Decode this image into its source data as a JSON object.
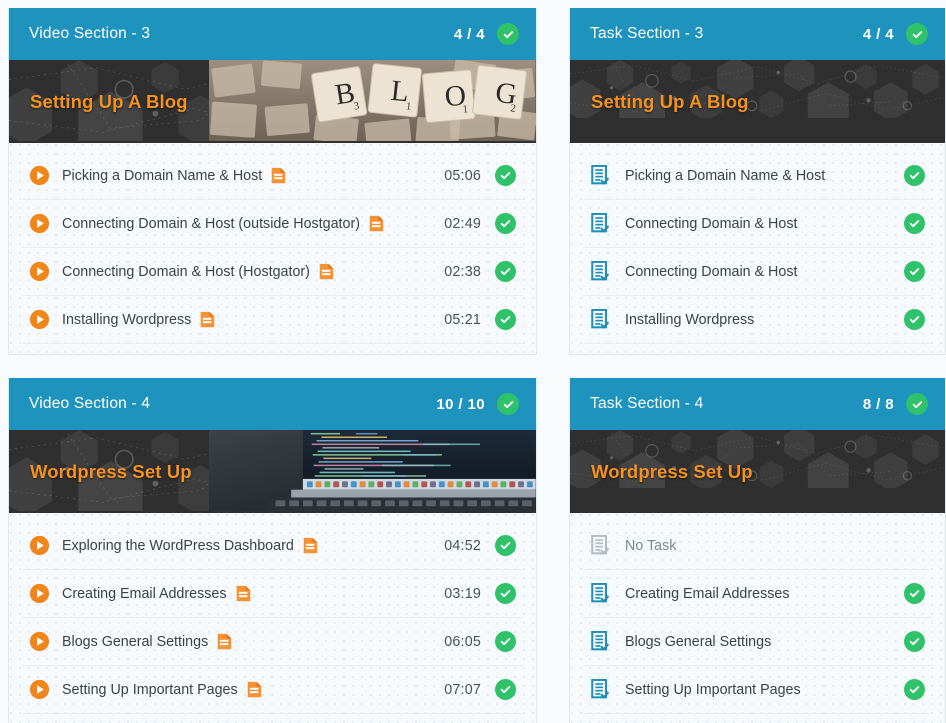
{
  "theme": {
    "header_bg": "#1d93bd",
    "banner_bg": "#2f2f2f",
    "banner_title_color": "#f5911e",
    "check_green": "#2fc26a",
    "video_icon_orange": "#f0861a",
    "task_icon_teal": "#1d93bd",
    "list_bg": "#f7fafc",
    "page_bg": "#f8fbfc"
  },
  "panels": [
    {
      "id": "video-section-3",
      "kind": "video",
      "title": "Video Section - 3",
      "count": "4 / 4",
      "complete": true,
      "banner_title": "Setting Up A Blog",
      "banner_image": "scrabble-blog-tiles-photo",
      "items": [
        {
          "label": "Picking a Domain Name & Host",
          "time": "05:06",
          "has_doc": true,
          "done": true
        },
        {
          "label": "Connecting Domain & Host (outside Hostgator)",
          "time": "02:49",
          "has_doc": true,
          "done": true
        },
        {
          "label": "Connecting Domain & Host (Hostgator)",
          "time": "02:38",
          "has_doc": true,
          "done": true
        },
        {
          "label": "Installing Wordpress",
          "time": "05:21",
          "has_doc": true,
          "done": true
        }
      ]
    },
    {
      "id": "task-section-3",
      "kind": "task",
      "title": "Task Section - 3",
      "count": "4 / 4",
      "complete": true,
      "banner_title": "Setting Up A Blog",
      "banner_image": "hexagon-network-pattern",
      "items": [
        {
          "label": "Picking a Domain Name & Host",
          "time": "",
          "has_doc": false,
          "done": true
        },
        {
          "label": "Connecting Domain & Host",
          "time": "",
          "has_doc": false,
          "done": true
        },
        {
          "label": "Connecting Domain & Host",
          "time": "",
          "has_doc": false,
          "done": true
        },
        {
          "label": "Installing Wordpress",
          "time": "",
          "has_doc": false,
          "done": true
        }
      ]
    },
    {
      "id": "video-section-4",
      "kind": "video",
      "title": "Video Section - 4",
      "count": "10 / 10",
      "complete": true,
      "banner_title": "Wordpress Set Up",
      "banner_image": "laptop-code-photo",
      "items": [
        {
          "label": "Exploring the WordPress Dashboard",
          "time": "04:52",
          "has_doc": true,
          "done": true
        },
        {
          "label": "Creating Email Addresses",
          "time": "03:19",
          "has_doc": true,
          "done": true
        },
        {
          "label": "Blogs General Settings",
          "time": "06:05",
          "has_doc": true,
          "done": true
        },
        {
          "label": "Setting Up Important Pages",
          "time": "07:07",
          "has_doc": true,
          "done": true
        }
      ]
    },
    {
      "id": "task-section-4",
      "kind": "task",
      "title": "Task Section - 4",
      "count": "8 / 8",
      "complete": true,
      "banner_title": "Wordpress Set Up",
      "banner_image": "hexagon-network-pattern",
      "items": [
        {
          "label": "No Task",
          "time": "",
          "has_doc": false,
          "done": false,
          "empty": true
        },
        {
          "label": "Creating Email Addresses",
          "time": "",
          "has_doc": false,
          "done": true
        },
        {
          "label": "Blogs General Settings",
          "time": "",
          "has_doc": false,
          "done": true
        },
        {
          "label": "Setting Up Important Pages",
          "time": "",
          "has_doc": false,
          "done": true
        }
      ]
    }
  ]
}
